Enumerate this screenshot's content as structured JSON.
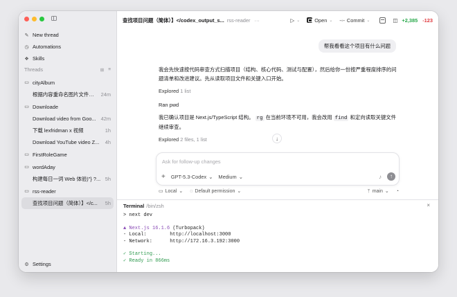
{
  "sidebar": {
    "nav": [
      {
        "icon": "new-thread-icon",
        "glyph": "✎",
        "label": "New thread"
      },
      {
        "icon": "automations-icon",
        "glyph": "◷",
        "label": "Automations"
      },
      {
        "icon": "skills-icon",
        "glyph": "❖",
        "label": "Skills"
      }
    ],
    "threads_label": "Threads",
    "folders": [
      {
        "name": "cityAlbum",
        "threads": [
          {
            "title": "根据内容重命名图片文件名...",
            "age": "24m"
          }
        ]
      },
      {
        "name": "Downloade",
        "threads": [
          {
            "title": "Download video from Goo...",
            "age": "42m"
          },
          {
            "title": "下载 lexfridman x 视频",
            "age": "1h"
          },
          {
            "title": "Download YouTube video Z...",
            "age": "4h"
          }
        ]
      },
      {
        "name": "FirstRoleGame",
        "threads": []
      },
      {
        "name": "wordAday",
        "threads": [
          {
            "title": "构建每日一词 Web 体验)\"} ?...",
            "age": "5h"
          }
        ]
      },
      {
        "name": "rss-reader",
        "threads": [
          {
            "title": "查找项目问题（简体）】</c...",
            "age": "5h"
          }
        ]
      }
    ],
    "settings": "Settings"
  },
  "header": {
    "title": "查找项目问题（简体）】</codex_output_s...",
    "project": "rss-reader",
    "more": "···",
    "open_label": "Open",
    "commit_label": "Commit",
    "additions": "+2,385",
    "deletions": "-123"
  },
  "chat": {
    "user_message": "帮我看看这个项目有什么问题",
    "reply1": "我会先快速按代码审查方式扫描项目（结构、核心代码、测试与配置），然后给你一份按严重程度排序的问题清单和改进建议。先从读取项目文件和关键入口开始。",
    "explored1": "Explored",
    "explored1_detail": "1 list",
    "ran": "Ran pwd",
    "reply2_a": "我已确认项目是 Next.js/TypeScript 结构。",
    "reply2_code1": "rg",
    "reply2_b": "在当前环境不可用，我会改用",
    "reply2_code2": "find",
    "reply2_c": "和定向读取关键文件继续审查。",
    "explored2": "Explored",
    "explored2_detail": "2 files, 1 list"
  },
  "composer": {
    "placeholder": "Ask for follow-up changes",
    "model": "GPT-5.3-Codex",
    "effort": "Medium",
    "env": "Local",
    "permission": "Default permission",
    "branch": "main"
  },
  "terminal": {
    "title": "Terminal",
    "path": "/bin/zsh",
    "cmd": "> next dev",
    "next_name": "▲ Next.js 16.1.6",
    "next_mode": " (Turbopack)",
    "local_label": "- Local:",
    "local_url": "http://localhost:3000",
    "network_label": "- Network:",
    "network_url": "http://172.16.3.192:3000",
    "starting": "✓ Starting...",
    "ready": "✓ Ready in 866ms"
  },
  "colors": {
    "additions": "#27a84a",
    "deletions": "#e0393e",
    "nextjs": "#8a4bb6",
    "ok": "#2e9a4e"
  }
}
